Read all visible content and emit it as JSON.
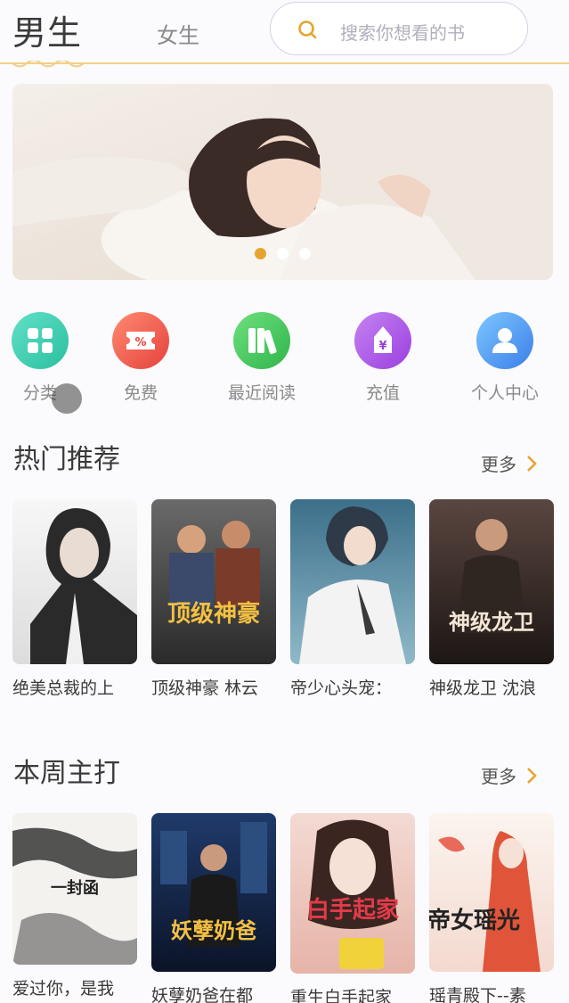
{
  "header": {
    "tab_boys": "男生",
    "tab_girls": "女生",
    "search_placeholder": "搜索你想看的书"
  },
  "banner": {
    "slide_count": 3,
    "active_index": 0
  },
  "nav": [
    {
      "label": "分类",
      "icon": "grid-icon"
    },
    {
      "label": "免费",
      "icon": "coupon-icon"
    },
    {
      "label": "最近阅读",
      "icon": "books-icon"
    },
    {
      "label": "充值",
      "icon": "yen-bag-icon"
    },
    {
      "label": "个人中心",
      "icon": "user-icon"
    }
  ],
  "sections": [
    {
      "title": "热门推荐",
      "more": "更多",
      "books": [
        {
          "title": "绝美总裁的上",
          "cover_text": ""
        },
        {
          "title": "顶级神豪 林云",
          "cover_text": "顶级神豪"
        },
        {
          "title": "帝少心头宠：",
          "cover_text": ""
        },
        {
          "title": "神级龙卫 沈浪",
          "cover_text": "神级龙卫"
        }
      ]
    },
    {
      "title": "本周主打",
      "more": "更多",
      "books": [
        {
          "title": "爱过你，是我",
          "cover_text": "一封函"
        },
        {
          "title": "妖孽奶爸在都",
          "cover_text": "妖孽奶爸"
        },
        {
          "title": "重生白手起家",
          "cover_text": "白手起家"
        },
        {
          "title": "瑶青殿下--素",
          "cover_text": "帝女瑶光"
        }
      ]
    }
  ],
  "colors": {
    "accent": "#e6a42e",
    "header_line": "#f2cf88"
  }
}
